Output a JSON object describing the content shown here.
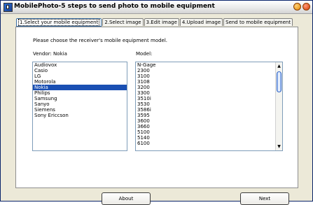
{
  "window": {
    "title": "MobilePhoto-5 steps to send photo to mobile equipment"
  },
  "tabs": [
    {
      "label": "1.Select your mobile equipment",
      "active": true
    },
    {
      "label": "2.Select image",
      "active": false
    },
    {
      "label": "3.Edit image",
      "active": false
    },
    {
      "label": "4.Upload image",
      "active": false
    },
    {
      "label": "Send to mobile equipment",
      "active": false
    }
  ],
  "content": {
    "instruction": "Please choose the receiver's mobile equipment model.",
    "vendor_label": "Vendor: Nokia",
    "model_label": "Model:",
    "vendors": [
      "Audiovox",
      "Casio",
      "LG",
      "Motorola",
      "Nokia",
      "Philips",
      "Samsung",
      "Sanyo",
      "Siemens",
      "Sony Ericcson"
    ],
    "selected_vendor": "Nokia",
    "models": [
      "N-Gage",
      "2300",
      "3100",
      "3108",
      "3200",
      "3300",
      "3510i",
      "3530",
      "3586i",
      "3595",
      "3600",
      "3660",
      "5100",
      "5140",
      "6100"
    ]
  },
  "buttons": {
    "about": "About",
    "next": "Next"
  },
  "colors": {
    "selection": "#1a4fb3",
    "active_tab_border": "#3a6ea5",
    "background": "#ece9d8"
  },
  "icons": {
    "app": "app-icon",
    "minimize": "minimize-icon",
    "close": "close-icon",
    "scroll_up": "arrow-up-icon",
    "scroll_down": "arrow-down-icon"
  }
}
